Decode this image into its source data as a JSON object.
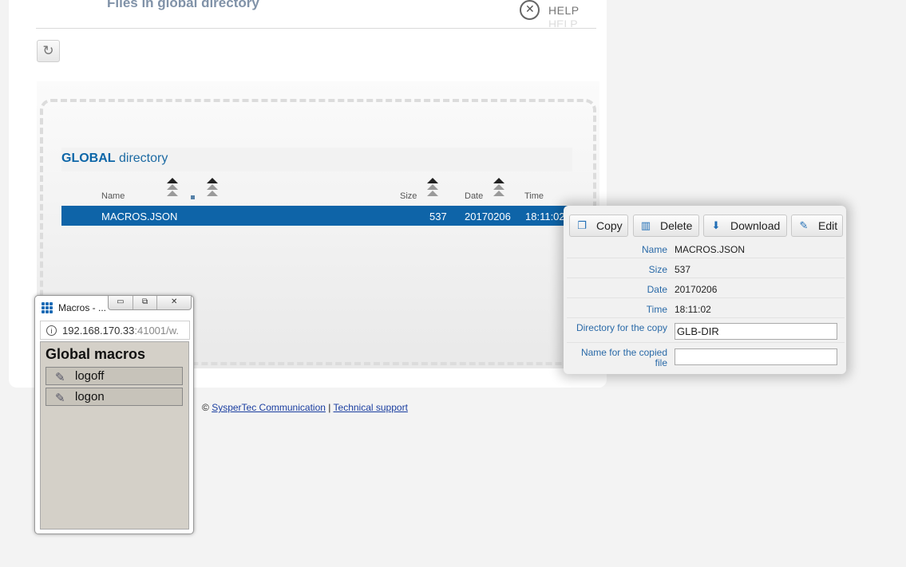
{
  "page": {
    "title": "Files in global directory",
    "help_label": "HELP"
  },
  "directory": {
    "name_bold": "GLOBAL",
    "name_rest": "directory",
    "columns": {
      "name": "Name",
      "size": "Size",
      "date": "Date",
      "time": "Time"
    },
    "rows": [
      {
        "name": "MACROS.JSON",
        "size": "537",
        "date": "20170206",
        "time": "18:11:02"
      }
    ]
  },
  "details": {
    "buttons": {
      "copy": "Copy",
      "delete": "Delete",
      "download": "Download",
      "edit": "Edit"
    },
    "fields": {
      "name_label": "Name",
      "name_value": "MACROS.JSON",
      "size_label": "Size",
      "size_value": "537",
      "date_label": "Date",
      "date_value": "20170206",
      "time_label": "Time",
      "time_value": "18:11:02",
      "dir_copy_label": "Directory for the copy",
      "dir_copy_value": "GLB-DIR",
      "name_copied_label_1": "Name for the copied",
      "name_copied_label_2": "file",
      "name_copied_value": ""
    }
  },
  "popup": {
    "window_title": "Macros - ...",
    "url_host": "192.168.170.33",
    "url_rest": ":41001/w.",
    "heading": "Global macros",
    "macros": [
      {
        "label": "logoff"
      },
      {
        "label": "logon"
      }
    ]
  },
  "footer": {
    "copyright": "©",
    "company_link": "SysperTec Communication",
    "separator": "|",
    "support_link": "Technical support"
  }
}
